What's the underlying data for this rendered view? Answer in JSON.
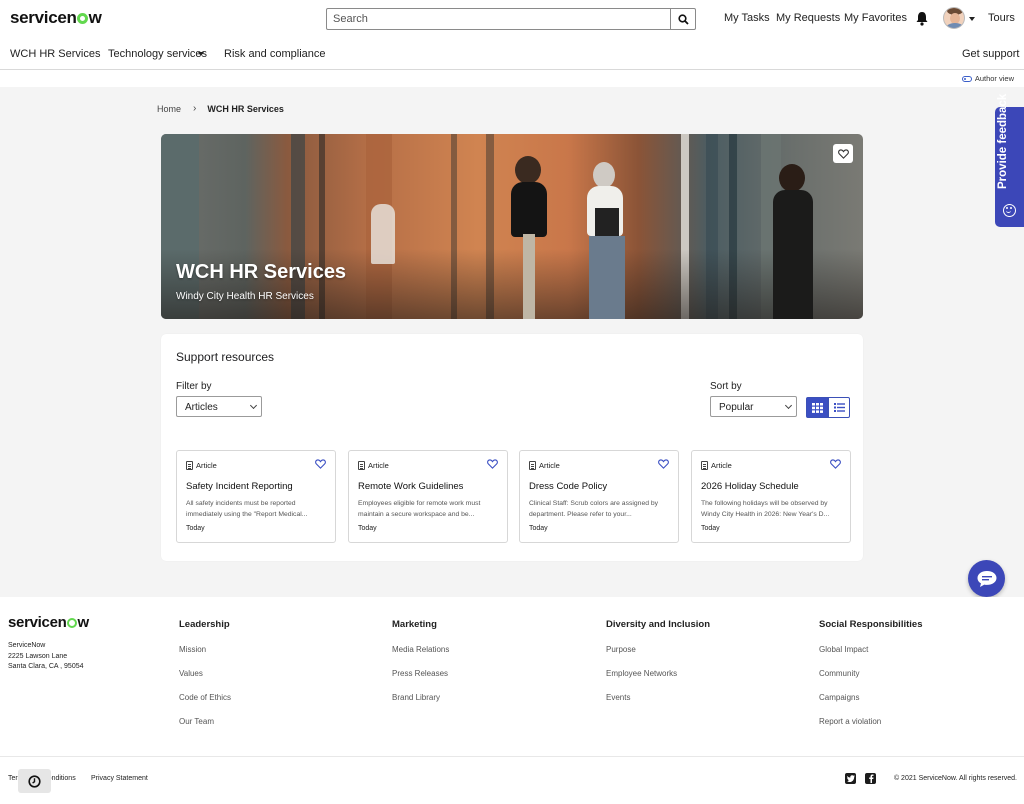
{
  "header": {
    "logo_text_pre": "servicen",
    "logo_text_post": "w",
    "search_placeholder": "Search",
    "links": [
      "My Tasks",
      "My Requests",
      "My Favorites"
    ],
    "tours": "Tours"
  },
  "nav": {
    "items": [
      "WCH HR Services",
      "Technology services",
      "Risk and compliance"
    ],
    "get_support": "Get support"
  },
  "author_view": "Author view",
  "breadcrumb": {
    "home": "Home",
    "current": "WCH HR Services"
  },
  "hero": {
    "title": "WCH HR Services",
    "subtitle": "Windy City Health HR Services"
  },
  "resources": {
    "title": "Support resources",
    "filter_label": "Filter by",
    "filter_value": "Articles",
    "sort_label": "Sort by",
    "sort_value": "Popular",
    "articles": [
      {
        "type": "Article",
        "title": "Safety Incident Reporting",
        "desc": "All safety incidents must be reported immediately using the \"Report Medical...",
        "date": "Today"
      },
      {
        "type": "Article",
        "title": "Remote Work Guidelines",
        "desc": "Employees eligible for remote work must maintain a secure workspace and be...",
        "date": "Today"
      },
      {
        "type": "Article",
        "title": "Dress Code Policy",
        "desc": "Clinical Staff: Scrub colors are assigned by department. Please refer to your...",
        "date": "Today"
      },
      {
        "type": "Article",
        "title": "2026 Holiday Schedule",
        "desc": "The following holidays will be observed by Windy City Health in 2026: New Year's D...",
        "date": "Today"
      }
    ]
  },
  "feedback": "Provide feedback",
  "footer": {
    "company": "ServiceNow",
    "address1": "2225 Lawson Lane",
    "address2": "Santa Clara, CA , 95054",
    "columns": [
      {
        "heading": "Leadership",
        "links": [
          "Mission",
          "Values",
          "Code of Ethics",
          "Our Team"
        ]
      },
      {
        "heading": "Marketing",
        "links": [
          "Media Relations",
          "Press Releases",
          "Brand Library"
        ]
      },
      {
        "heading": "Diversity and Inclusion",
        "links": [
          "Purpose",
          "Employee Networks",
          "Events"
        ]
      },
      {
        "heading": "Social Responsibilities",
        "links": [
          "Global Impact",
          "Community",
          "Campaigns",
          "Report a violation"
        ]
      }
    ],
    "terms": "Terms and Conditions",
    "privacy": "Privacy Statement",
    "copyright": "© 2021 ServiceNow. All rights reserved."
  },
  "colors": {
    "accent": "#3c47b8",
    "logo_green": "#62d84e",
    "page_bg": "#f4f4f4"
  },
  "icons": [
    "search-icon",
    "bell-icon",
    "heart-icon",
    "document-icon",
    "grid-view-icon",
    "list-view-icon",
    "chat-icon",
    "smile-icon",
    "twitter-icon",
    "facebook-icon",
    "clock-icon"
  ]
}
